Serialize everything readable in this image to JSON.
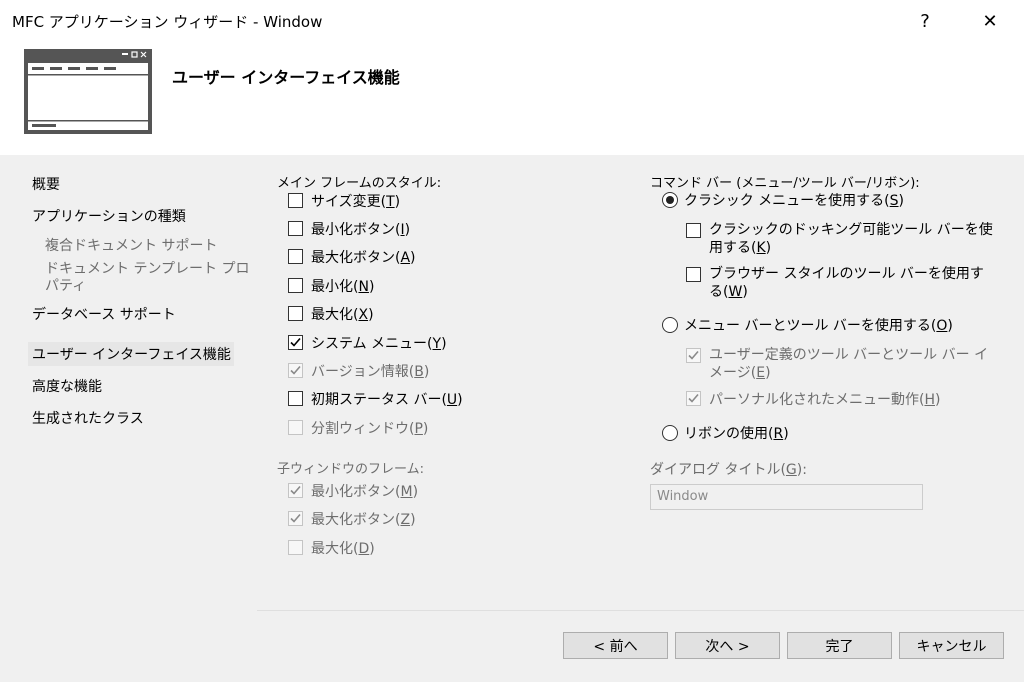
{
  "window": {
    "title": "MFC アプリケーション ウィザード - Window",
    "help_label": "?",
    "close_label": "✕"
  },
  "header": {
    "title": "ユーザー インターフェイス機能"
  },
  "sidebar": {
    "items": [
      {
        "label": "概要",
        "level": 0,
        "selected": false
      },
      {
        "label": "アプリケーションの種類",
        "level": 0,
        "selected": false
      },
      {
        "label": "複合ドキュメント サポート",
        "level": 1,
        "selected": false
      },
      {
        "label": "ドキュメント テンプレート プロパティ",
        "level": 1,
        "selected": false
      },
      {
        "label": "データベース サポート",
        "level": 0,
        "selected": false
      },
      {
        "label": "ユーザー インターフェイス機能",
        "level": 0,
        "selected": true
      },
      {
        "label": "高度な機能",
        "level": 0,
        "selected": false
      },
      {
        "label": "生成されたクラス",
        "level": 0,
        "selected": false
      }
    ]
  },
  "main_frame": {
    "label": "メイン フレームのスタイル:",
    "options": [
      {
        "label": "サイズ変更",
        "key": "T",
        "checked": false,
        "enabled": true
      },
      {
        "label": "最小化ボタン",
        "key": "I",
        "checked": false,
        "enabled": true
      },
      {
        "label": "最大化ボタン",
        "key": "A",
        "checked": false,
        "enabled": true
      },
      {
        "label": "最小化",
        "key": "N",
        "checked": false,
        "enabled": true
      },
      {
        "label": "最大化",
        "key": "X",
        "checked": false,
        "enabled": true
      },
      {
        "label": "システム メニュー",
        "key": "Y",
        "checked": true,
        "enabled": true
      },
      {
        "label": "バージョン情報",
        "key": "B",
        "checked": true,
        "enabled": false
      },
      {
        "label": "初期ステータス バー",
        "key": "U",
        "checked": false,
        "enabled": true
      },
      {
        "label": "分割ウィンドウ",
        "key": "P",
        "checked": false,
        "enabled": false
      }
    ]
  },
  "child_frame": {
    "label": "子ウィンドウのフレーム:",
    "options": [
      {
        "label": "最小化ボタン",
        "key": "M",
        "checked": true,
        "enabled": false
      },
      {
        "label": "最大化ボタン",
        "key": "Z",
        "checked": true,
        "enabled": false
      },
      {
        "label": "最大化",
        "key": "D",
        "checked": false,
        "enabled": false
      }
    ]
  },
  "command_bar": {
    "label": "コマンド バー (メニュー/ツール バー/リボン):",
    "classic": {
      "label": "クラシック メニューを使用する",
      "key": "S",
      "selected": true
    },
    "classic_docking": {
      "label": "クラシックのドッキング可能ツール バーを使用する",
      "key": "K",
      "checked": false,
      "enabled": true
    },
    "browser_style": {
      "label": "ブラウザー スタイルのツール バーを使用する",
      "key": "W",
      "checked": false,
      "enabled": true
    },
    "menubar": {
      "label": "メニュー バーとツール バーを使用する",
      "key": "O",
      "selected": false
    },
    "user_defined": {
      "label": "ユーザー定義のツール バーとツール バー イメージ",
      "key": "E",
      "checked": true,
      "enabled": false
    },
    "personalized": {
      "label": "パーソナル化されたメニュー動作",
      "key": "H",
      "checked": true,
      "enabled": false
    },
    "ribbon": {
      "label": "リボンの使用",
      "key": "R",
      "selected": false
    }
  },
  "dialog_title": {
    "label": "ダイアログ タイトル",
    "key": "G",
    "value": "Window"
  },
  "buttons": {
    "prev": "< 前へ",
    "next": "次へ >",
    "finish": "完了",
    "cancel": "キャンセル"
  }
}
